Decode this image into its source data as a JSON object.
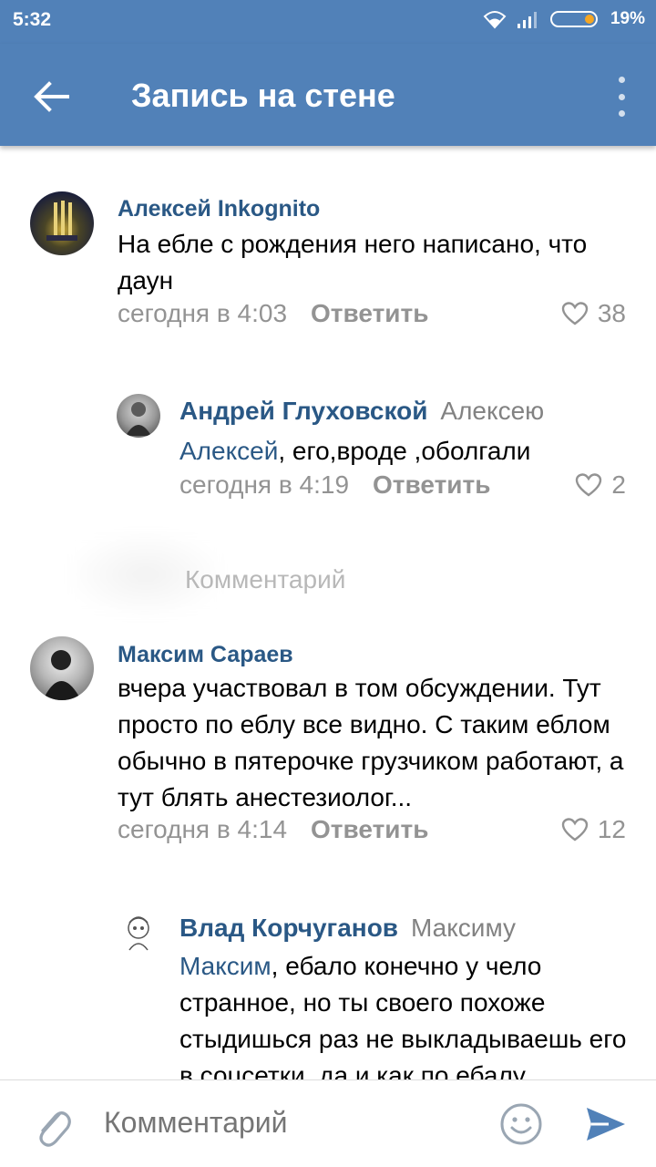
{
  "status_bar": {
    "time": "5:32",
    "battery_percent": "19%",
    "battery_level": 0.19
  },
  "header": {
    "title": "Запись на стене",
    "back_icon": "arrow-left-icon",
    "menu_icon": "more-vertical-icon"
  },
  "comments": [
    {
      "author": "Алексей Inkognito",
      "reply_to": "",
      "mention": "",
      "text": "На ебле с рождения него написано, что даун",
      "date": "сегодня в 4:03",
      "reply_label": "Ответить",
      "likes": "38"
    },
    {
      "author": "Андрей Глуховской",
      "reply_to": "Алексею",
      "mention": "Алексей",
      "text": ", его,вроде ,оболгали",
      "date": "сегодня в 4:19",
      "reply_label": "Ответить",
      "likes": "2"
    },
    {
      "author": "Максим Сараев",
      "reply_to": "",
      "mention": "",
      "text": "вчера участвовал в том обсуждении. Тут просто по еблу все видно. С таким еблом обычно в пятерочке грузчиком работают, а тут блять анестезиолог...",
      "date": "сегодня в 4:14",
      "reply_label": "Ответить",
      "likes": "12"
    },
    {
      "author": "Влад Корчуганов",
      "reply_to": "Максиму",
      "mention": "Максим",
      "text": ", ебало конечно у чело странное, но ты своего похоже стыдишься раз не выкладываешь его в соцсетки, да и как по ебалу"
    }
  ],
  "divider_label": "Комментарий",
  "compose": {
    "placeholder": "Комментарий",
    "attach_icon": "paperclip-icon",
    "emoji_icon": "smiley-icon",
    "send_icon": "send-icon"
  },
  "colors": {
    "header_blue": "#5181b8",
    "link_blue": "#2a5885",
    "meta_gray": "#939393"
  }
}
